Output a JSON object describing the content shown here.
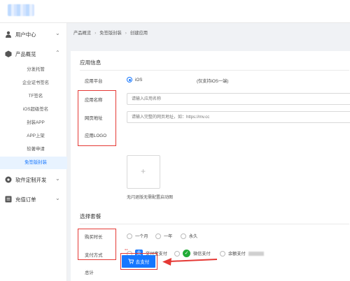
{
  "sidebar": {
    "groups": [
      {
        "label": "用户中心",
        "icon": "user-icon"
      },
      {
        "label": "产品概览",
        "icon": "box-icon"
      },
      {
        "label": "软件定制开发",
        "icon": "gear-icon"
      },
      {
        "label": "充值订单",
        "icon": "list-icon"
      }
    ],
    "items": [
      "分发托管",
      "企业证书签名",
      "TF签名",
      "iOS超级签名",
      "封装APP",
      "APP上架",
      "较著申请",
      "免签版封装"
    ]
  },
  "breadcrumb": [
    "产品概览",
    "免签版封装",
    "创建应用"
  ],
  "app_info": {
    "title": "应用信息",
    "platform_label": "应用平台",
    "platform_value": "iOS",
    "platform_note": "(仅支持iOS一端)",
    "name_label": "应用名称",
    "name_placeholder": "请输入应用名称",
    "url_label": "网页地址",
    "url_placeholder": "请输入完整的网页地址，如：https://mv.cc",
    "logo_label": "应用LOGO",
    "logo_hint": "无闪退版无需配置启动图"
  },
  "package": {
    "title": "选择套餐",
    "duration_label": "购买时长",
    "durations": [
      "一个月",
      "一年",
      "永久"
    ],
    "payment_label": "支付方式",
    "payments": [
      "文付宝支付",
      "微信支付",
      "余额支付"
    ],
    "total_label": "总计",
    "total_value": "--",
    "pay_button": "去支付"
  },
  "colors": {
    "accent": "#1677ff",
    "highlight": "#e53935",
    "alipay": "#1677ff",
    "wechat": "#22ac38"
  }
}
